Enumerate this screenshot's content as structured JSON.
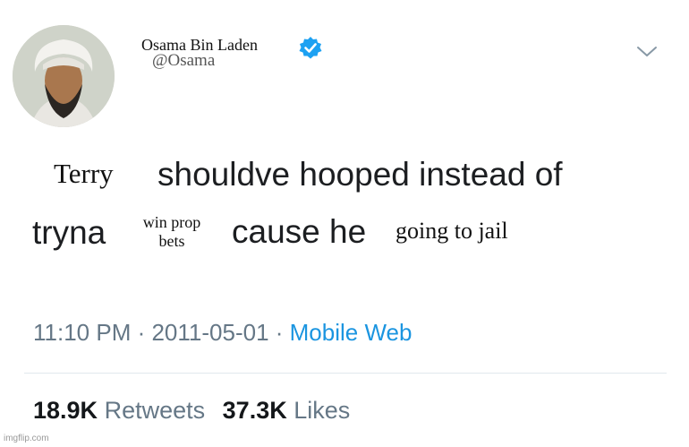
{
  "tweet": {
    "author_name": "Osama Bin Laden",
    "author_handle": "@Osama",
    "line1_fill": "Terry",
    "line1_text": "shouldve hooped instead of",
    "line2_prefix": "tryna",
    "line2_fill": "win prop bets",
    "line2_middle": "cause he",
    "line2_suffix_fill": "going to jail",
    "time": "11:10 PM · 2011-05-01 · ",
    "source": "Mobile Web",
    "retweets_count": "18.9K",
    "retweets_label": "Retweets",
    "likes_count": "37.3K",
    "likes_label": "Likes"
  },
  "watermark": "imgflip.com",
  "colors": {
    "verified": "#1da1f2",
    "link": "#1b95e0",
    "muted": "#657786"
  },
  "icons": {
    "verified": "verified-badge-icon",
    "chevron": "chevron-down-icon"
  }
}
